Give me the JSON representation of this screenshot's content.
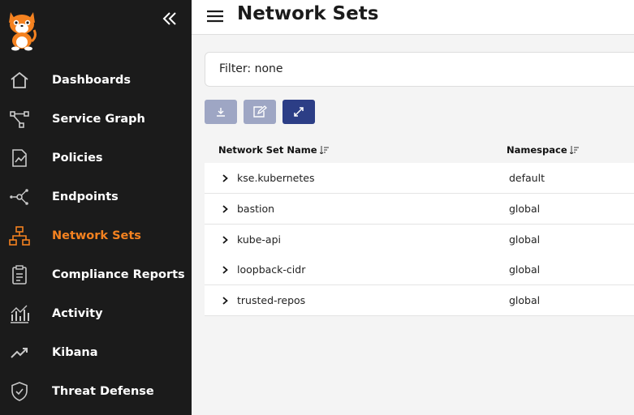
{
  "header": {
    "title": "Network Sets"
  },
  "sidebar": {
    "active_color": "#f58220",
    "items": [
      {
        "label": "Dashboards",
        "icon": "home-icon"
      },
      {
        "label": "Service Graph",
        "icon": "service-graph-icon"
      },
      {
        "label": "Policies",
        "icon": "policies-icon"
      },
      {
        "label": "Endpoints",
        "icon": "endpoints-icon"
      },
      {
        "label": "Network Sets",
        "icon": "network-sets-icon",
        "active": true
      },
      {
        "label": "Compliance Reports",
        "icon": "clipboard-icon"
      },
      {
        "label": "Activity",
        "icon": "activity-icon"
      },
      {
        "label": "Kibana",
        "icon": "kibana-icon"
      },
      {
        "label": "Threat Defense",
        "icon": "shield-icon"
      }
    ]
  },
  "filter": {
    "label": "Filter: none"
  },
  "toolbar": {
    "download": {
      "icon": "download-icon",
      "disabled": true
    },
    "edit": {
      "icon": "edit-icon",
      "disabled": true
    },
    "expand": {
      "icon": "expand-icon",
      "disabled": false
    }
  },
  "table": {
    "columns": [
      "Network Set Name",
      "Namespace"
    ],
    "rows": [
      {
        "name": "kse.kubernetes",
        "namespace": "default"
      },
      {
        "name": "bastion",
        "namespace": "global"
      },
      {
        "name": "kube-api",
        "namespace": "global"
      },
      {
        "name": "loopback-cidr",
        "namespace": "global"
      },
      {
        "name": "trusted-repos",
        "namespace": "global"
      }
    ]
  }
}
